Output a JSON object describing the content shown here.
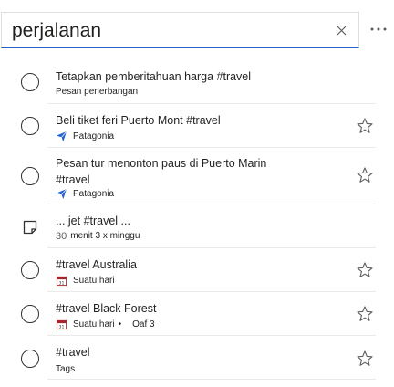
{
  "search": {
    "value": "perjalanan"
  },
  "tasks": [
    {
      "title": "Tetapkan pemberitahuan harga #travel",
      "meta": "Pesan penerbangan"
    },
    {
      "title": "Beli tiket feri Puerto Mont #travel",
      "meta": "Patagonia",
      "meta_icon": "airplane-icon"
    },
    {
      "title": "Pesan tur menonton paus di Puerto Marin",
      "title2": "#travel",
      "meta": "Patagonia",
      "meta_icon": "airplane-icon"
    },
    {
      "title": "... jet #travel ...",
      "meta_num": "30",
      "meta": "menit 3 x minggu"
    },
    {
      "title": "#travel Australia",
      "meta": "Suatu hari",
      "meta_icon": "calendar-icon"
    },
    {
      "title": "#travel Black Forest",
      "meta": "Suatu hari",
      "meta_sep": "•",
      "meta_extra": "Oaf 3",
      "meta_icon": "calendar-icon"
    },
    {
      "title": "#travel",
      "meta": "Tags"
    }
  ],
  "colors": {
    "accent": "#2564cf",
    "icon_blue": "#2564cf",
    "text": "#252423",
    "divider": "#edebe9"
  }
}
